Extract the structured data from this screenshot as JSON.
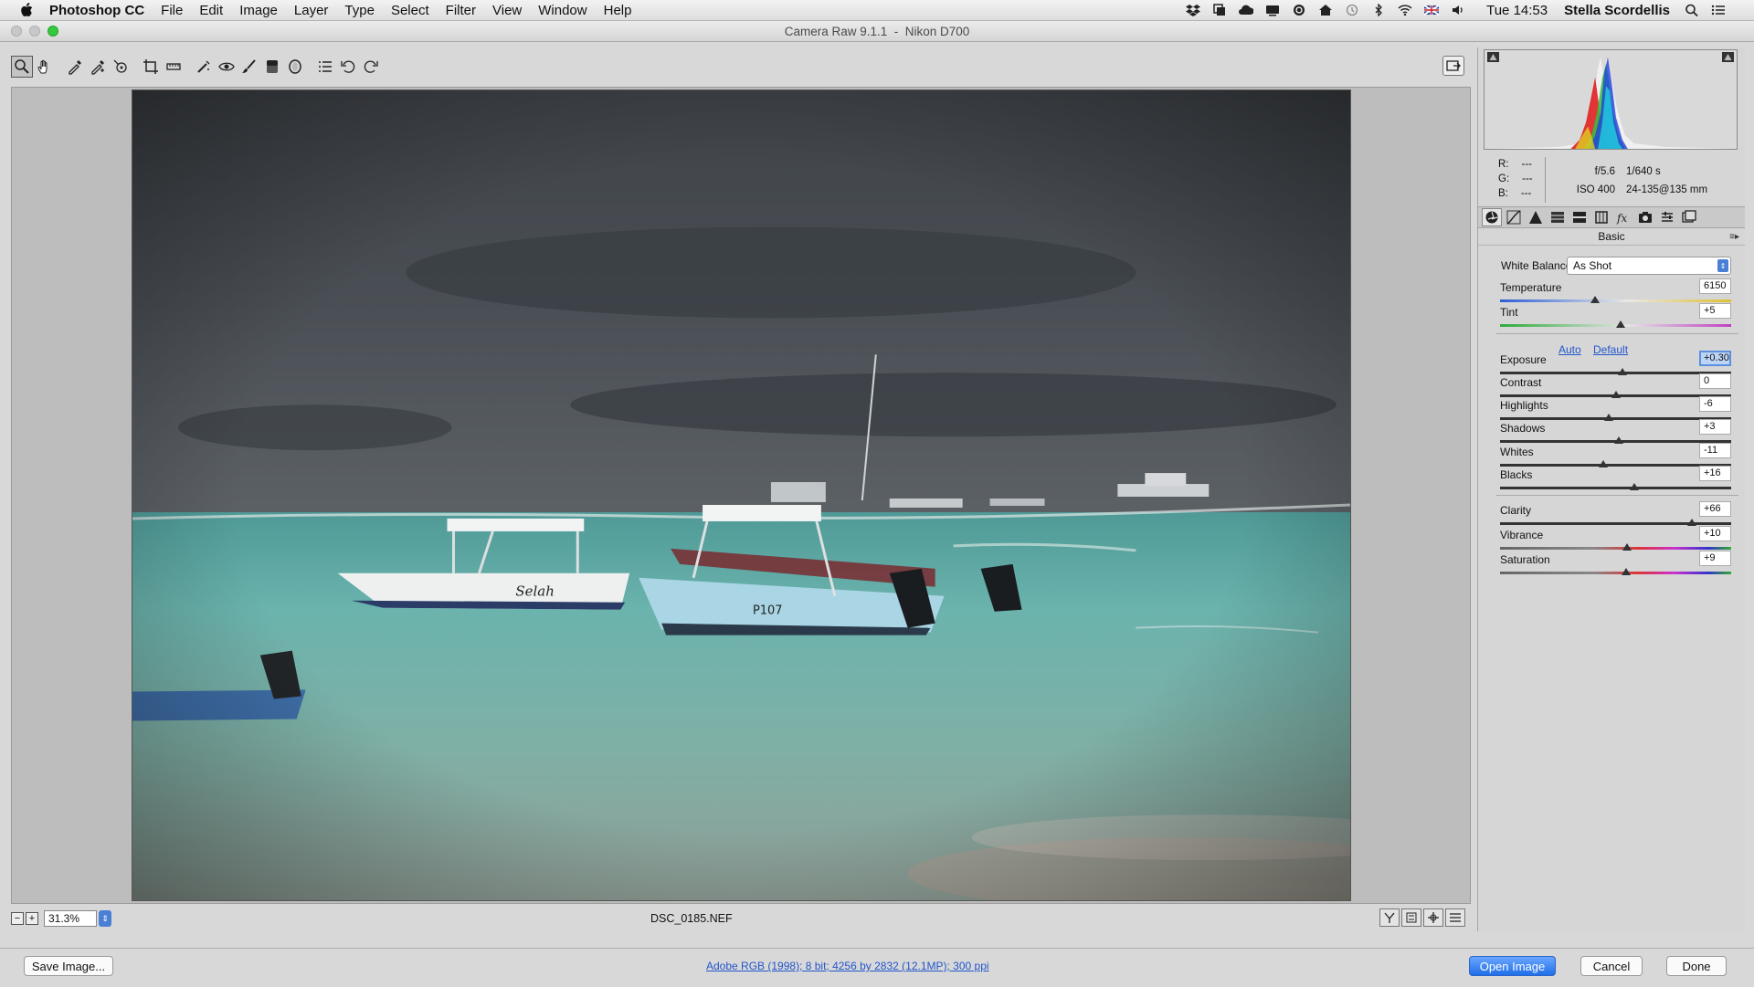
{
  "menubar": {
    "app": "Photoshop CC",
    "items": [
      "File",
      "Edit",
      "Image",
      "Layer",
      "Type",
      "Select",
      "Filter",
      "View",
      "Window",
      "Help"
    ],
    "clock": "Tue 14:53",
    "user": "Stella Scordellis"
  },
  "window": {
    "title": "Camera Raw 9.1.1  -  Nikon D700"
  },
  "status": {
    "zoom": "31.3%",
    "filename": "DSC_0185.NEF"
  },
  "info": {
    "r_label": "R:",
    "g_label": "G:",
    "b_label": "B:",
    "r": "---",
    "g": "---",
    "b": "---",
    "aperture": "f/5.6",
    "shutter": "1/640 s",
    "iso": "ISO 400",
    "lens": "24-135@135 mm"
  },
  "panel": {
    "title": "Basic",
    "wb_label": "White Balance:",
    "wb_value": "As Shot",
    "auto": "Auto",
    "default": "Default",
    "sliders": [
      {
        "label": "Temperature",
        "value": "6150",
        "pos": 0.41
      },
      {
        "label": "Tint",
        "value": "+5",
        "pos": 0.52
      },
      {
        "label": "Exposure",
        "value": "+0.30",
        "pos": 0.53
      },
      {
        "label": "Contrast",
        "value": "0",
        "pos": 0.5
      },
      {
        "label": "Highlights",
        "value": "-6",
        "pos": 0.47
      },
      {
        "label": "Shadows",
        "value": "+3",
        "pos": 0.515
      },
      {
        "label": "Whites",
        "value": "-11",
        "pos": 0.445
      },
      {
        "label": "Blacks",
        "value": "+16",
        "pos": 0.58
      },
      {
        "label": "Clarity",
        "value": "+66",
        "pos": 0.83
      },
      {
        "label": "Vibrance",
        "value": "+10",
        "pos": 0.55
      },
      {
        "label": "Saturation",
        "value": "+9",
        "pos": 0.545
      }
    ]
  },
  "bottom": {
    "save": "Save Image...",
    "workflow": "Adobe RGB (1998); 8 bit; 4256 by 2832 (12.1MP); 300 ppi",
    "open": "Open Image",
    "cancel": "Cancel",
    "done": "Done"
  }
}
